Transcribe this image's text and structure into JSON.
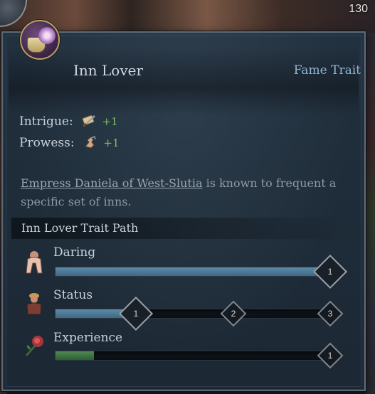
{
  "hud": {
    "counter": "130"
  },
  "tooltip": {
    "trait_name": "Inn Lover",
    "trait_type": "Fame Trait",
    "stats": [
      {
        "label": "Intrigue:",
        "bonus": "+1",
        "icon": "dagger-scroll-icon"
      },
      {
        "label": "Prowess:",
        "bonus": "+1",
        "icon": "fist-icon"
      }
    ],
    "description": {
      "link": "Empress Daniela of West-Slutia",
      "rest": " is known to frequent a specific set of inns."
    },
    "path_title": "Inn Lover Trait Path",
    "tracks": [
      {
        "label": "Daring",
        "icon": "daring-figure-icon",
        "progress": 1.0,
        "color": "#4f7b98",
        "milestones": [
          "1"
        ]
      },
      {
        "label": "Status",
        "icon": "status-figure-icon",
        "progress": 0.3,
        "color": "#4f7b98",
        "milestones": [
          "1",
          "2",
          "3"
        ]
      },
      {
        "label": "Experience",
        "icon": "rose-icon",
        "progress": 0.14,
        "color": "#3f7445",
        "milestones": [
          "1"
        ]
      }
    ]
  }
}
